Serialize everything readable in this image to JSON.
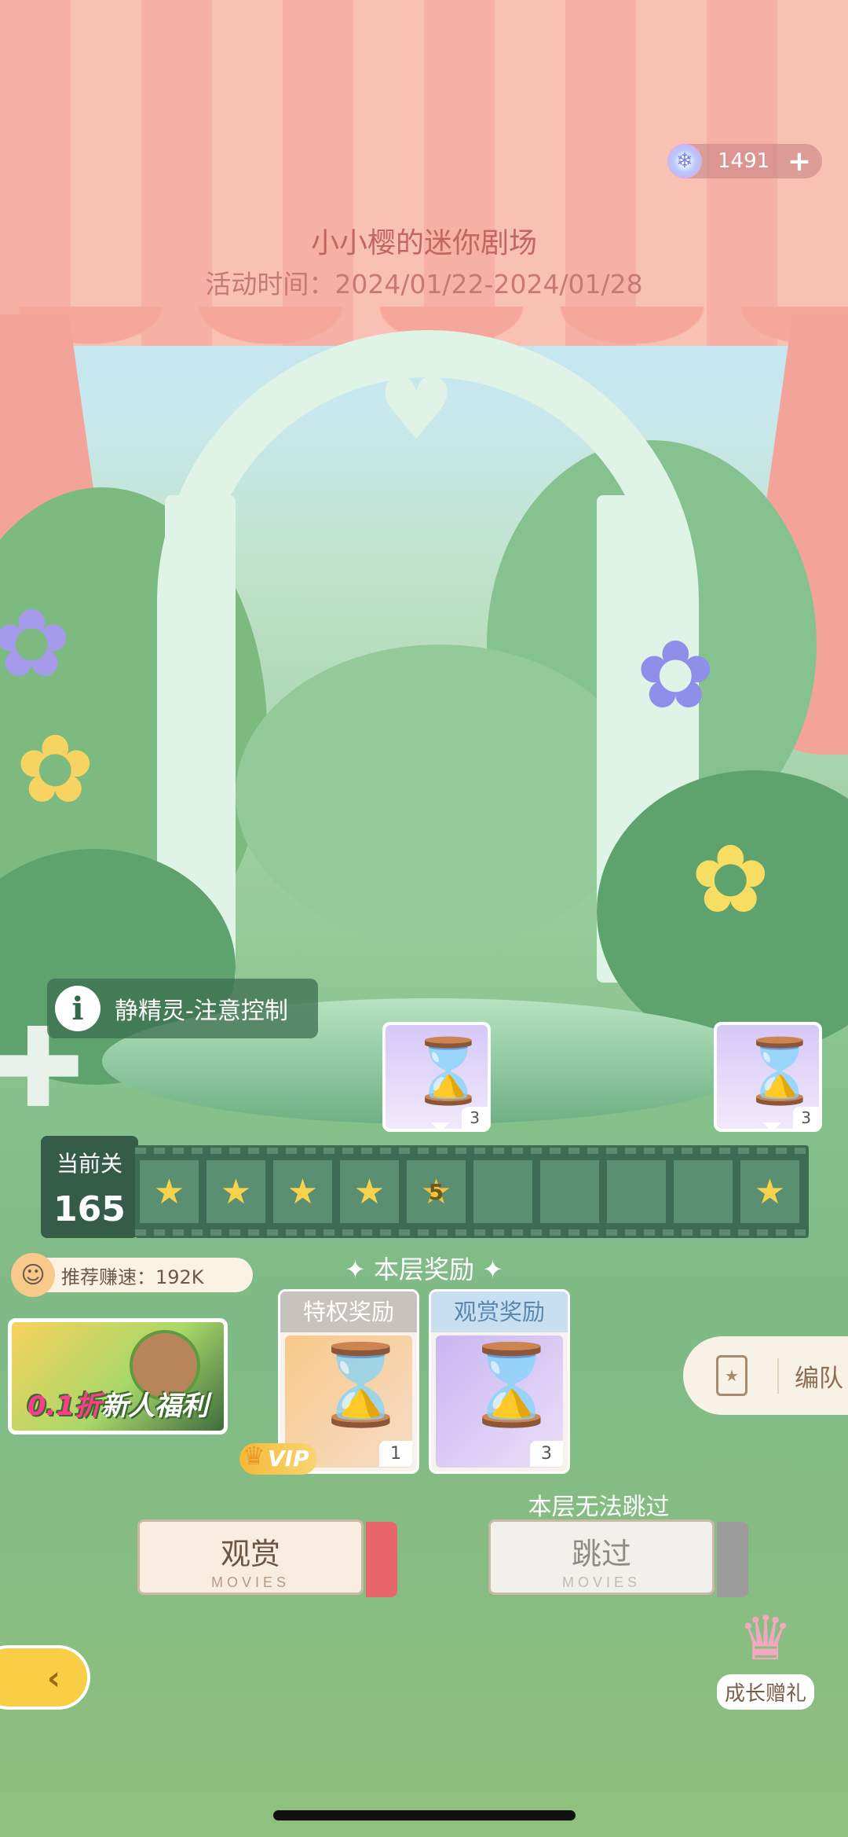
{
  "status": {
    "currency_amount": "1491",
    "currency_plus": "+"
  },
  "event": {
    "title": "小小樱的迷你剧场",
    "time": "活动时间：2024/01/22-2024/01/28"
  },
  "hint": {
    "icon_letter": "i",
    "text": "静精灵-注意控制"
  },
  "preview_rewards": [
    {
      "count": "3"
    },
    {
      "count": "3"
    }
  ],
  "level": {
    "label": "当前关",
    "number": "165",
    "current_stage": "5",
    "stages": [
      "star",
      "star",
      "star",
      "star",
      "current",
      "empty",
      "empty",
      "empty",
      "empty",
      "star"
    ]
  },
  "recommend_speed": "推荐赚速：192K",
  "section_title": "✦ 本层奖励 ✦",
  "promo": {
    "discount": "0.1折",
    "text": "新人福利"
  },
  "rewards": {
    "privilege": {
      "label": "特权奖励",
      "count": "1",
      "badge": "VIP"
    },
    "watch": {
      "label": "观赏奖励",
      "count": "3"
    }
  },
  "team_button": "编队",
  "cannot_skip_note": "本层无法跳过",
  "buttons": {
    "watch": {
      "label": "观赏",
      "sub": "MOVIES"
    },
    "skip": {
      "label": "跳过",
      "sub": "MOVIES"
    }
  },
  "growth_gift": "成长赠礼",
  "colors": {
    "accent_yellow": "#f9ce45",
    "film_green": "#3d6b53",
    "ticket_red": "#e8666a",
    "title_pink": "#c0675f"
  }
}
